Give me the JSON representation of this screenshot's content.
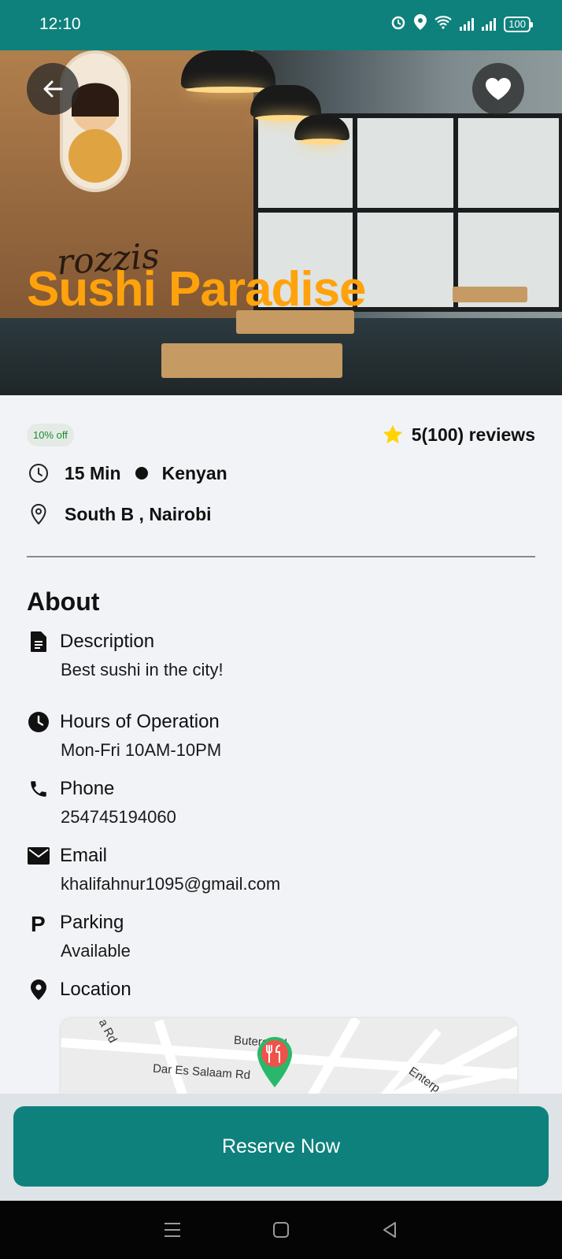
{
  "status_bar": {
    "time": "12:10",
    "battery": "100"
  },
  "hero": {
    "title": "Sushi Paradise",
    "poster_word": "rozzis",
    "title_color": "#ffa20c"
  },
  "restaurant": {
    "discount": "10% off",
    "rating": "5(100) reviews",
    "time": "15 Min",
    "cuisine": "Kenyan",
    "address": "South B , Nairobi"
  },
  "about": {
    "title": "About",
    "items": [
      {
        "icon": "document-icon",
        "label": "Description",
        "value": "Best sushi in the city!"
      },
      {
        "icon": "clock-icon",
        "label": "Hours of Operation",
        "value": "Mon-Fri 10AM-10PM"
      },
      {
        "icon": "phone-icon",
        "label": "Phone",
        "value": "254745194060"
      },
      {
        "icon": "mail-icon",
        "label": "Email",
        "value": "khalifahnur1095@gmail.com"
      },
      {
        "icon": "parking-icon",
        "label": "Parking",
        "value": "Available"
      },
      {
        "icon": "location-pin-icon",
        "label": "Location",
        "value": ""
      }
    ]
  },
  "map": {
    "labels": [
      "Butere Rd",
      "Dar Es Salaam Rd",
      "Enterp",
      "a Rd"
    ]
  },
  "actions": {
    "reserve_label": "Reserve Now"
  },
  "colors": {
    "primary": "#0e817c",
    "accent": "#ffa20c",
    "star": "#ffd400",
    "discount_text": "#1d8a30"
  }
}
